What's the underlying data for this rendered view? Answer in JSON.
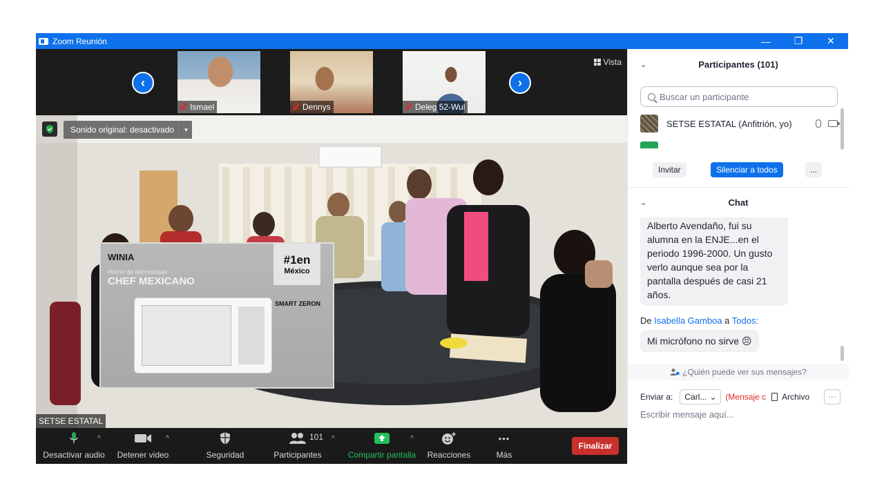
{
  "window": {
    "title": "Zoom Reunión",
    "controls": {
      "minimize": "—",
      "restore": "❐",
      "close": "✕"
    }
  },
  "thumbnails": [
    {
      "name": "Ismael",
      "muted": true
    },
    {
      "name": "Dennys",
      "muted": true
    },
    {
      "name": "Deleg 52-Wul",
      "muted": true
    }
  ],
  "strip_nav": {
    "prev": "‹",
    "next": "›"
  },
  "view_button": "Vista",
  "video": {
    "sound_button": "Sonido original: desactivado",
    "sound_caret": "▾",
    "participant_name": "SETSE ESTATAL",
    "box_brand": "WINIA",
    "box_title": "CHEF MEXICANO",
    "box_subtitle": "Horno de Microondas",
    "box_badge_1": "#1en",
    "box_badge_2": "México",
    "box_feature": "SMART ZERON"
  },
  "toolbar": {
    "items": [
      {
        "label": "Desactivar audio",
        "icon": "microphone-icon",
        "has_caret": true
      },
      {
        "label": "Detener video",
        "icon": "video-camera-icon",
        "has_caret": true
      },
      {
        "label": "Seguridad",
        "icon": "shield-icon",
        "has_caret": false
      },
      {
        "label": "Participantes",
        "icon": "participants-icon",
        "has_caret": true,
        "count": "101"
      },
      {
        "label": "Compartir pantalla",
        "icon": "share-screen-icon",
        "has_caret": true
      },
      {
        "label": "Reacciones",
        "icon": "reaction-icon",
        "has_caret": false
      },
      {
        "label": "Más",
        "icon": "more-icon",
        "has_caret": false
      }
    ],
    "caret": "^",
    "more_glyph": "•••",
    "end_button": "Finalizar",
    "colors": {
      "share": "#21c05a",
      "end": "#c8302c",
      "accent": "#0e71eb"
    }
  },
  "participants_panel": {
    "title": "Participantes (101)",
    "collapse": "⌄",
    "search_placeholder": "Buscar un participante",
    "participants": [
      {
        "name": "SETSE ESTATAL (Anfitrión, yo)"
      }
    ],
    "buttons": {
      "invite": "Invitar",
      "mute_all": "Silenciar a todos",
      "more": "..."
    }
  },
  "chat_panel": {
    "title": "Chat",
    "collapse": "⌄",
    "messages": [
      {
        "text_lines": [
          "Alberto Avendaño, fui su",
          "alumna en la ENJE...en el",
          "periodo 1996-2000. Un gusto",
          "verlo aunque sea por la",
          "pantalla después de casi 21",
          "años."
        ]
      },
      {
        "from_prefix": "De",
        "from_name": "Isabella Gamboa",
        "to_sep": "a",
        "to_name": "Todos:",
        "text": "Mi micrófono no sirve 😣"
      }
    ],
    "who_can_see": "¿Quién puede ver sus mensajes?",
    "send_to_label": "Enviar a:",
    "send_to_value": "Carl...",
    "send_to_caret": "⌄",
    "private_note": "(Mensaje c",
    "file_label": "Archivo",
    "more_dots": "···",
    "input_placeholder": "Escribir mensaje aquí..."
  }
}
